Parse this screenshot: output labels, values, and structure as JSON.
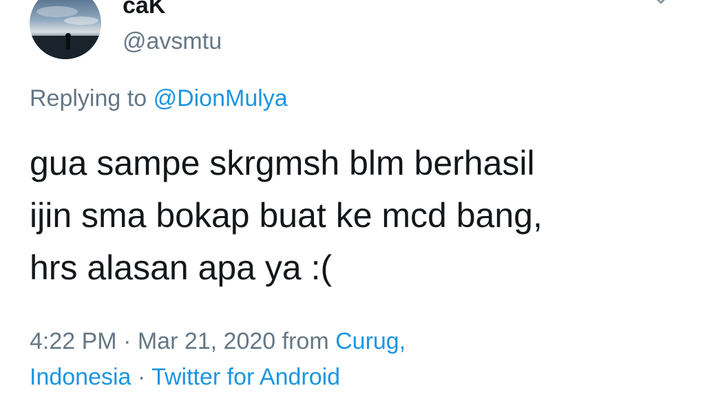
{
  "user": {
    "display_name": "caK",
    "handle": "@avsmtu"
  },
  "reply": {
    "prefix": "Replying to",
    "mention": "@DionMulya"
  },
  "tweet": {
    "lines": [
      "gua sampe skrgmsh blm berhasil",
      "ijin sma bokap buat ke mcd bang,",
      "hrs alasan apa ya :("
    ]
  },
  "meta": {
    "time": "4:22 PM",
    "separator1": " · ",
    "date": "Mar 21, 2020",
    "from_label": " from ",
    "location_part1": "Curug,",
    "location_part2": "Indonesia",
    "separator2": " · ",
    "source": "Twitter for Android"
  },
  "icons": {
    "avatar": "profile-photo",
    "menu": "chevron-down-icon"
  },
  "colors": {
    "text": "#14171a",
    "muted": "#657786",
    "link": "#1b95e0"
  }
}
